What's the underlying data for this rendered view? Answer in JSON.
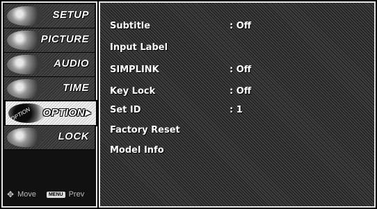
{
  "sidebar": {
    "items": [
      {
        "label": "SETUP",
        "active": false
      },
      {
        "label": "PICTURE",
        "active": false
      },
      {
        "label": "AUDIO",
        "active": false
      },
      {
        "label": "TIME",
        "active": false
      },
      {
        "label": "OPTION",
        "active": true,
        "icon_text": "OPTION",
        "arrow": "▸"
      },
      {
        "label": "LOCK",
        "active": false
      }
    ],
    "footer": {
      "move_label": "Move",
      "move_icon": "✥",
      "menu_key": "MENU",
      "prev_label": "Prev"
    }
  },
  "options": [
    {
      "name": "Subtitle",
      "value": ": Off"
    },
    {
      "name": "Input Label",
      "value": ""
    },
    {
      "name": "SIMPLINK",
      "value": ": Off"
    },
    {
      "name": "Key Lock",
      "value": ": Off"
    },
    {
      "name": "Set ID",
      "value": ": 1"
    },
    {
      "name": "Factory Reset",
      "value": ""
    },
    {
      "name": "Model Info",
      "value": ""
    }
  ]
}
